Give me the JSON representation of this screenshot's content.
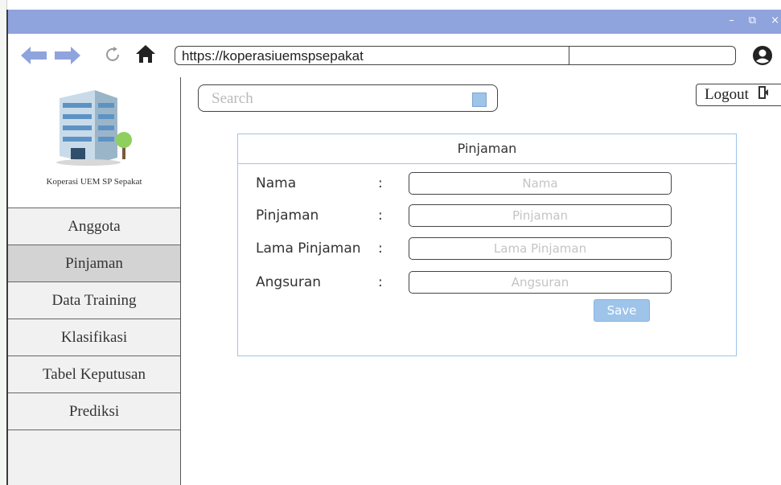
{
  "browser": {
    "url": "https://koperasiuemspsepakat",
    "colors": {
      "titlebar": "#8fa3dd",
      "nav_arrow": "#8fa3dd"
    },
    "icons": [
      "back-arrow-icon",
      "forward-arrow-icon",
      "reload-icon",
      "home-icon",
      "account-icon"
    ],
    "window_controls": {
      "minimize": "–",
      "restore": "⧉",
      "close": "×"
    }
  },
  "sidebar": {
    "org_name": "Koperasi UEM SP Sepakat",
    "items": [
      {
        "label": "Anggota",
        "active": false
      },
      {
        "label": "Pinjaman",
        "active": true
      },
      {
        "label": "Data Training",
        "active": false
      },
      {
        "label": "Klasifikasi",
        "active": false
      },
      {
        "label": "Tabel Keputusan",
        "active": false
      },
      {
        "label": "Prediksi",
        "active": false
      }
    ]
  },
  "header": {
    "search_placeholder": "Search",
    "logout_label": "Logout"
  },
  "form": {
    "title": "Pinjaman",
    "fields": [
      {
        "label": "Nama",
        "colon": ":",
        "placeholder": "Nama"
      },
      {
        "label": "Pinjaman",
        "colon": ":",
        "placeholder": "Pinjaman"
      },
      {
        "label": "Lama Pinjaman",
        "colon": ":",
        "placeholder": "Lama Pinjaman"
      },
      {
        "label": "Angsuran",
        "colon": ":",
        "placeholder": "Angsuran"
      }
    ],
    "save_label": "Save",
    "accent_color": "#9ec4ea"
  }
}
